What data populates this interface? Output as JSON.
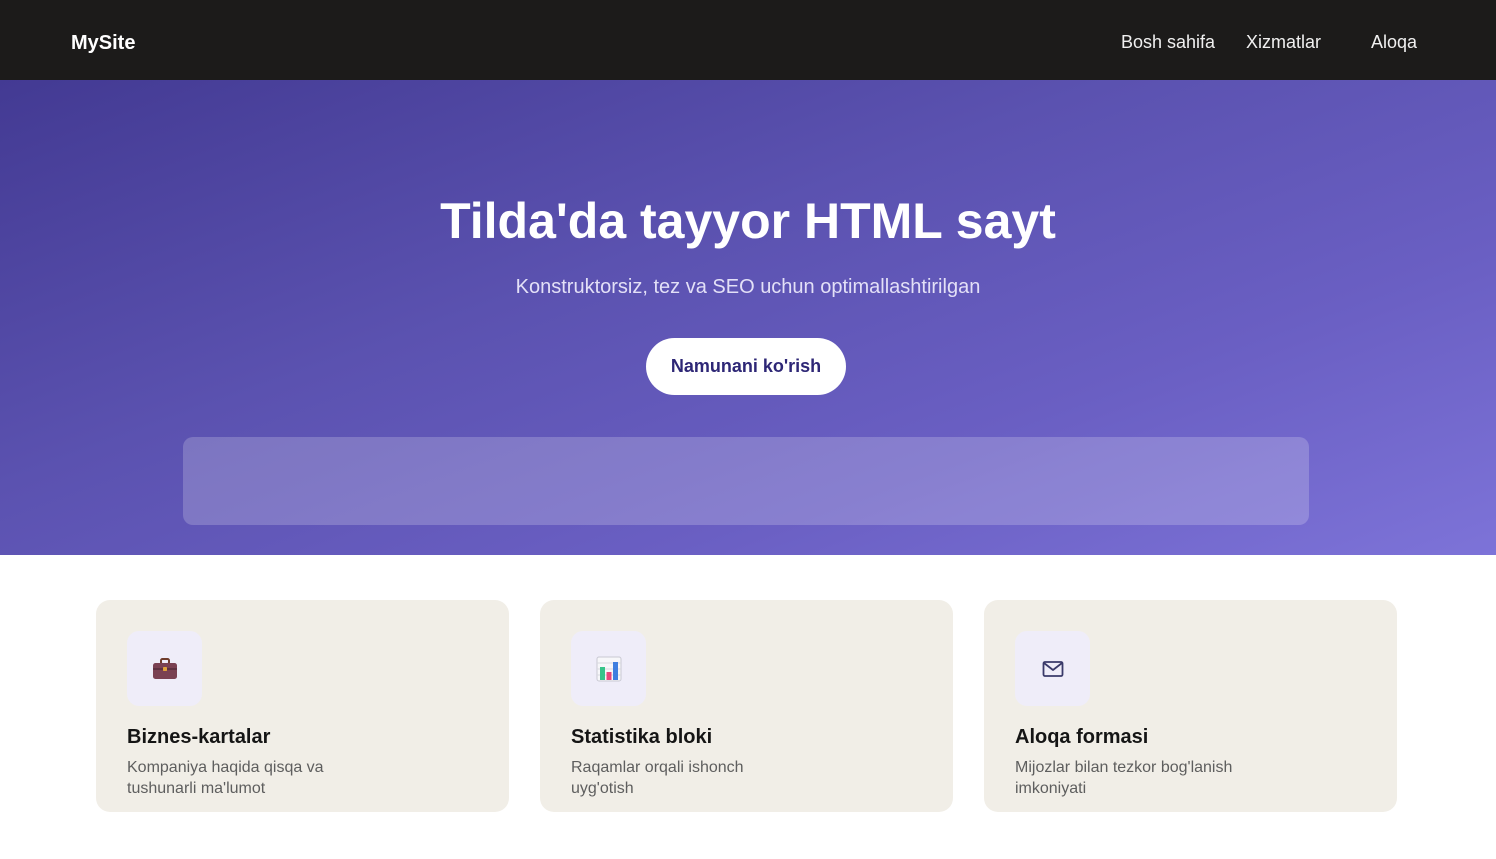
{
  "header": {
    "brand": "MySite",
    "nav": [
      {
        "label": "Bosh sahifa"
      },
      {
        "label": "Xizmatlar"
      },
      {
        "label": "Aloqa"
      }
    ]
  },
  "hero": {
    "title": "Tilda'da tayyor HTML sayt",
    "subtitle": "Konstruktorsiz, tez va SEO uchun optimallashtirilgan",
    "cta_label": "Namunani ko'rish"
  },
  "features": [
    {
      "icon": "briefcase-icon",
      "title": "Biznes-kartalar",
      "desc": "Kompaniya haqida qisqa va tushunarli ma'lumot"
    },
    {
      "icon": "bar-chart-icon",
      "title": "Statistika bloki",
      "desc": "Raqamlar orqali ishonch uyg'otish"
    },
    {
      "icon": "envelope-icon",
      "title": "Aloqa formasi",
      "desc": "Mijozlar bilan tezkor bog'lanish imkoniyati"
    }
  ],
  "colors": {
    "header_bg": "#1c1b1a",
    "hero_gradient_start": "#433a93",
    "hero_gradient_end": "#7d73d8",
    "cta_text": "#2e2776",
    "card_bg": "#f1eee7",
    "icon_tile_bg": "#efedf9"
  }
}
